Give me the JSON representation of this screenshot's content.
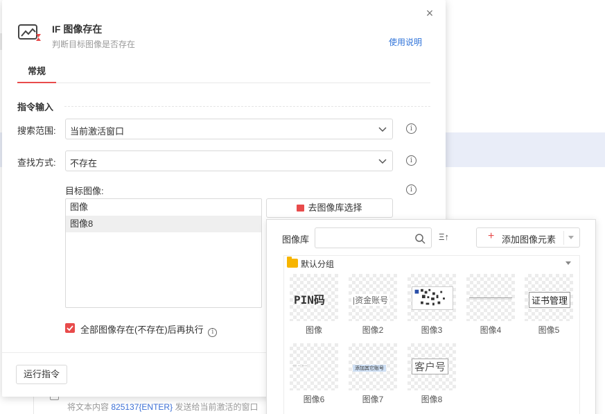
{
  "background": {
    "footer_prefix": "将文本内容",
    "footer_highlight": "825137{ENTER}",
    "footer_suffix": "发送给当前激活的窗口"
  },
  "dialog": {
    "title": "IF 图像存在",
    "subtitle": "判断目标图像是否存在",
    "help_link": "使用说明",
    "close_glyph": "×",
    "tabs": [
      {
        "label": "常规",
        "active": true
      }
    ],
    "section_title": "指令输入",
    "search_scope": {
      "label": "搜索范围:",
      "value": "当前激活窗口"
    },
    "find_mode": {
      "label": "查找方式:",
      "value": "不存在"
    },
    "target_image": {
      "label": "目标图像:",
      "items": [
        {
          "label": "图像",
          "selected": false
        },
        {
          "label": "图像8",
          "selected": true
        }
      ]
    },
    "library_button": "去图像库选择",
    "checkbox": {
      "label": "全部图像存在(不存在)后再执行",
      "checked": true
    },
    "run_button": "运行指令",
    "info_glyph": "i"
  },
  "popup": {
    "label": "图像库",
    "search_placeholder": "",
    "sort_glyph": "Ξ↑",
    "add_button": "添加图像元素",
    "add_glyph": "+",
    "group_name": "默认分组",
    "images": [
      {
        "name": "图像",
        "content": "PIN码"
      },
      {
        "name": "图像2",
        "content": "|资金账号"
      },
      {
        "name": "图像3",
        "content": ""
      },
      {
        "name": "图像4",
        "content": ""
      },
      {
        "name": "图像5",
        "content": "证书管理"
      },
      {
        "name": "图像6",
        "content": "··· ·· ····"
      },
      {
        "name": "图像7",
        "content": "添加其它账号"
      },
      {
        "name": "图像8",
        "content": "客户号"
      }
    ]
  },
  "colors": {
    "accent": "#e84b4b",
    "link": "#2f73d9",
    "folder": "#f7b500"
  }
}
